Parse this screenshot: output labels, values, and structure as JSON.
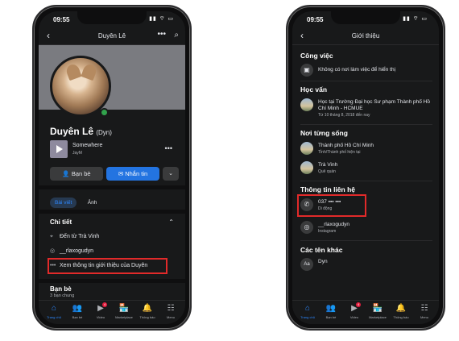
{
  "left": {
    "status": {
      "time": "09:55",
      "icons": "▮▮ ⌔ ▭"
    },
    "nav": {
      "title": "Duyên Lê",
      "back": "‹",
      "more": "•••",
      "search": "⌕"
    },
    "profile": {
      "name": "Duyên Lê",
      "nickname": "(Dyn)"
    },
    "music": {
      "song": "Somewhere",
      "artist": "JayM",
      "more": "•••"
    },
    "buttons": {
      "friends": "Bạn bè",
      "message": "Nhắn tin",
      "dropdown": "⌄"
    },
    "tabs": [
      "Bài viết",
      "Ảnh"
    ],
    "details": {
      "title": "Chi tiết",
      "hometown": "Đến từ Trà Vinh",
      "instagram": "__rlaxogudyn",
      "see_about": "Xem thông tin giới thiệu của Duyên"
    },
    "friends": {
      "title": "Bạn bè",
      "mutual": "3 bạn chung"
    }
  },
  "right": {
    "status": {
      "time": "09:55",
      "icons": "▮▮ ⌔ ▭"
    },
    "nav": {
      "title": "Giới thiệu",
      "back": "‹"
    },
    "work": {
      "title": "Công việc",
      "text": "Không có nơi làm việc để hiển thị"
    },
    "education": {
      "title": "Học vấn",
      "text": "Học tại Trường Đại học Sư phạm Thành phố Hồ Chí Minh - HCMUE",
      "sub": "Từ 10 tháng 8, 2018 đến nay"
    },
    "places": {
      "title": "Nơi từng sống",
      "items": [
        {
          "name": "Thành phố Hồ Chí Minh",
          "sub": "Tỉnh/Thành phố hiện tại"
        },
        {
          "name": "Trà Vinh",
          "sub": "Quê quán"
        }
      ]
    },
    "contact": {
      "title": "Thông tin liên hệ",
      "phone": "037 ▪▪▪ ▪▪▪",
      "phone_sub": "Di động",
      "instagram": "__rlaxogudyn",
      "instagram_sub": "Instagram"
    },
    "other_names": {
      "title": "Các tên khác",
      "name": "Dyn"
    }
  },
  "tabbar": {
    "items": [
      {
        "label": "Trang chủ",
        "icon": "⌂"
      },
      {
        "label": "Bạn bè",
        "icon": "👥"
      },
      {
        "label": "Video",
        "icon": "▶",
        "badge": "4"
      },
      {
        "label": "Marketplace",
        "icon": "🏪"
      },
      {
        "label": "Thông báo",
        "icon": "🔔"
      },
      {
        "label": "Menu",
        "icon": "☷"
      }
    ]
  },
  "colors": {
    "accent": "#2374e1",
    "highlight": "#e12a2a",
    "online": "#31a24c",
    "bg": "#18191a"
  }
}
